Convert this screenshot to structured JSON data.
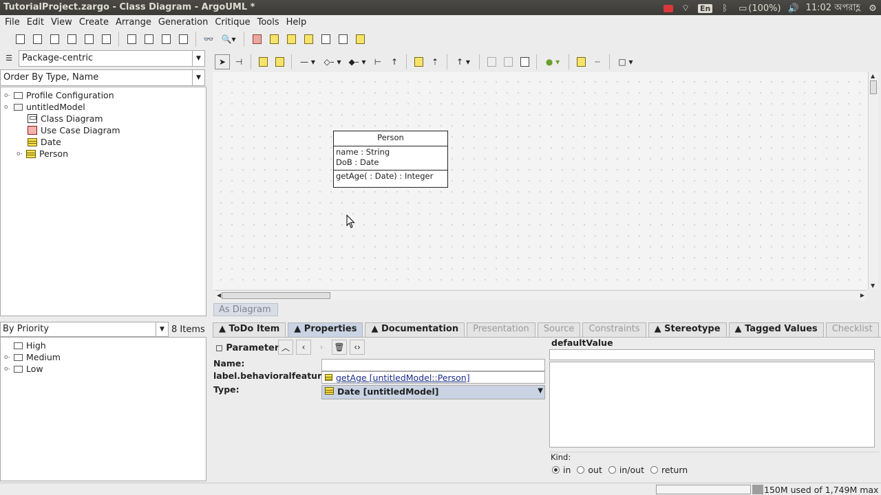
{
  "window": {
    "title": "TutorialProject.zargo - Class Diagram - ArgoUML *"
  },
  "system_tray": {
    "battery": "(100%)",
    "clock": "11:02 অপরাহ্ণ",
    "keyboard": "En"
  },
  "menu": [
    "File",
    "Edit",
    "View",
    "Create",
    "Arrange",
    "Generation",
    "Critique",
    "Tools",
    "Help"
  ],
  "explorer": {
    "perspective": "Package-centric",
    "order": "Order By Type, Name",
    "tree": [
      {
        "label": "Profile Configuration",
        "icon": "folder-icon",
        "level": 0
      },
      {
        "label": "untitledModel",
        "icon": "folder-open-icon",
        "level": 0
      },
      {
        "label": "Class Diagram",
        "icon": "class-diagram-icon",
        "level": 1
      },
      {
        "label": "Use Case Diagram",
        "icon": "usecase-diagram-icon",
        "level": 1
      },
      {
        "label": "Date",
        "icon": "class-icon",
        "level": 1
      },
      {
        "label": "Person",
        "icon": "class-icon",
        "level": 1
      }
    ]
  },
  "diagram": {
    "tab_label": "As Diagram",
    "class_box": {
      "name": "Person",
      "attributes": [
        "name : String",
        "DoB : Date"
      ],
      "operations": [
        "getAge( : Date) : Integer"
      ]
    }
  },
  "todo": {
    "sort_by": "By Priority",
    "count": "8 Items",
    "groups": [
      "High",
      "Medium",
      "Low"
    ]
  },
  "details": {
    "tabs": [
      {
        "label": "ToDo Item",
        "state": "normal"
      },
      {
        "label": "Properties",
        "state": "active"
      },
      {
        "label": "Documentation",
        "state": "normal"
      },
      {
        "label": "Presentation",
        "state": "disabled"
      },
      {
        "label": "Source",
        "state": "disabled"
      },
      {
        "label": "Constraints",
        "state": "disabled"
      },
      {
        "label": "Stereotype",
        "state": "normal"
      },
      {
        "label": "Tagged Values",
        "state": "normal"
      },
      {
        "label": "Checklist",
        "state": "disabled"
      }
    ],
    "element_type": "Parameter",
    "name_label": "Name:",
    "name_value": "",
    "behavioral_label": "label.behavioralfeature",
    "behavioral_value": "getAge [untitledModel::Person]",
    "type_label": "Type:",
    "type_value": "Date [untitledModel]",
    "default_value_label": "defaultValue",
    "kind_label": "Kind:",
    "kind_options": [
      "in",
      "out",
      "in/out",
      "return"
    ],
    "kind_selected": "in"
  },
  "status": {
    "memory": "150M used of 1,749M max"
  }
}
